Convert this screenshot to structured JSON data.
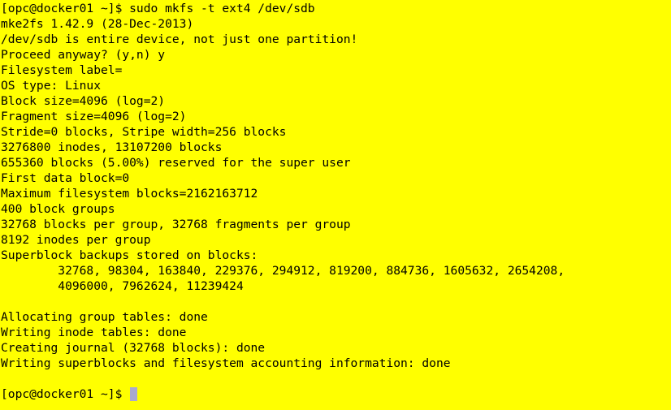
{
  "terminal": {
    "background_color": "#ffff00",
    "text_color": "#000000",
    "cursor_color": "#a9a9cf",
    "lines": [
      "[opc@docker01 ~]$ sudo mkfs -t ext4 /dev/sdb",
      "mke2fs 1.42.9 (28-Dec-2013)",
      "/dev/sdb is entire device, not just one partition!",
      "Proceed anyway? (y,n) y",
      "Filesystem label=",
      "OS type: Linux",
      "Block size=4096 (log=2)",
      "Fragment size=4096 (log=2)",
      "Stride=0 blocks, Stripe width=256 blocks",
      "3276800 inodes, 13107200 blocks",
      "655360 blocks (5.00%) reserved for the super user",
      "First data block=0",
      "Maximum filesystem blocks=2162163712",
      "400 block groups",
      "32768 blocks per group, 32768 fragments per group",
      "8192 inodes per group",
      "Superblock backups stored on blocks:",
      "        32768, 98304, 163840, 229376, 294912, 819200, 884736, 1605632, 2654208,",
      "        4096000, 7962624, 11239424",
      "",
      "Allocating group tables: done",
      "Writing inode tables: done",
      "Creating journal (32768 blocks): done",
      "Writing superblocks and filesystem accounting information: done",
      "",
      "[opc@docker01 ~]$ "
    ]
  }
}
